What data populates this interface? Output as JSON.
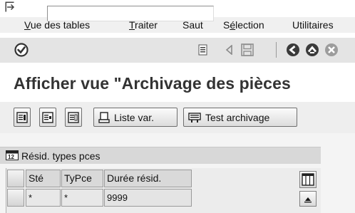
{
  "window": {
    "menu_icon": "menu-toggle-icon"
  },
  "menubar": {
    "items": [
      {
        "label_u": "V",
        "label_rest": "ue des tables"
      },
      {
        "label_u": "T",
        "label_rest": "raiter"
      },
      {
        "label_u": "",
        "label_rest": "Saut"
      },
      {
        "label_pre": "S",
        "label_u": "é",
        "label_rest": "lection"
      },
      {
        "label_u": "",
        "label_rest": "Utilitaires"
      }
    ]
  },
  "toolbar": {
    "command_field_value": "",
    "icons": [
      "enter-check-icon",
      "dropdown-list-icon",
      "prev-icon",
      "save-icon",
      "back-icon",
      "exit-icon",
      "cancel-icon"
    ]
  },
  "page": {
    "title": "Afficher vue \"Archivage des pièces"
  },
  "app_toolbar": {
    "list_var_label": "Liste var.",
    "test_archive_label": "Test archivage"
  },
  "table_control": {
    "title": "Résid. types pces",
    "columns": [
      "Sté",
      "TyPce",
      "Durée résid."
    ],
    "rows": [
      [
        "*",
        "*",
        "9999"
      ]
    ]
  },
  "colors": {
    "menubar_bg": "#f0f0f0",
    "toolbar_bg": "#e4e4e4",
    "title_color": "#333333",
    "grid_header_bg": "#d9d9d9"
  }
}
